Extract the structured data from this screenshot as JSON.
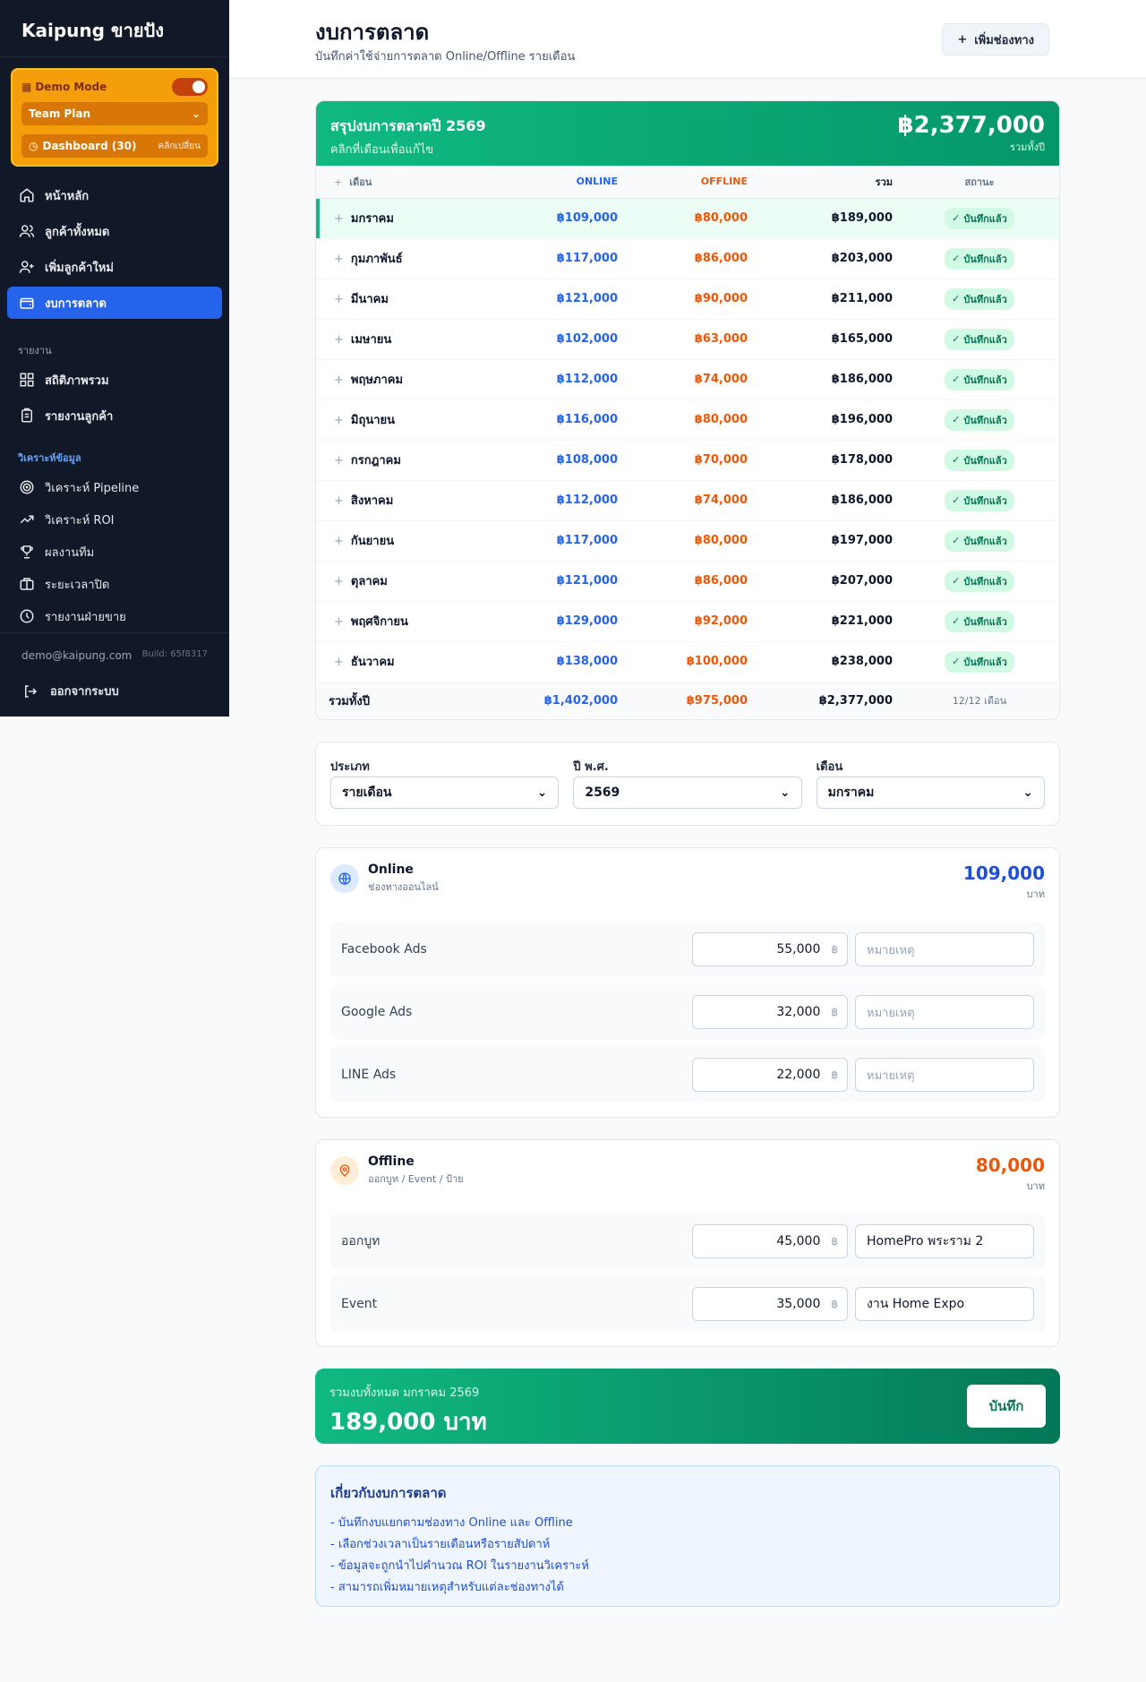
{
  "sidebar": {
    "brand": "Kaipung ขายปัง",
    "demo": {
      "title": "Demo Mode",
      "plan": "Team Plan",
      "dashboard_label": "Dashboard (30)",
      "dashboard_hint": "คลิกเปลี่ยน"
    },
    "nav": [
      {
        "label": "หน้าหลัก",
        "icon": "home-icon"
      },
      {
        "label": "ลูกค้าทั้งหมด",
        "icon": "users-icon"
      },
      {
        "label": "เพิ่มลูกค้าใหม่",
        "icon": "user-plus-icon"
      },
      {
        "label": "งบการตลาด",
        "icon": "wallet-icon",
        "active": true
      }
    ],
    "section_reports": "รายงาน",
    "reports": [
      {
        "label": "สถิติภาพรวม",
        "icon": "grid-icon"
      },
      {
        "label": "รายงานลูกค้า",
        "icon": "clipboard-icon"
      }
    ],
    "section_analysis": "วิเคราะห์ข้อมูล",
    "analysis": [
      {
        "label": "วิเคราะห์ Pipeline",
        "icon": "target-icon"
      },
      {
        "label": "วิเคราะห์ ROI",
        "icon": "trending-up-icon"
      },
      {
        "label": "ผลงานทีม",
        "icon": "trophy-icon"
      },
      {
        "label": "ระยะเวลาปิด",
        "icon": "briefcase-icon"
      },
      {
        "label": "รายงานฝ่ายขาย",
        "icon": "clock-icon"
      }
    ],
    "email": "demo@kaipung.com",
    "build": "Build: 65f8317",
    "logout": "ออกจากระบบ"
  },
  "header": {
    "title": "งบการตลาด",
    "subtitle": "บันทึกค่าใช้จ่ายการตลาด Online/Offline รายเดือน",
    "add_channel": "เพิ่มช่องทาง"
  },
  "summary": {
    "title": "สรุปงบการตลาดปี 2569",
    "subtitle": "คลิกที่เดือนเพื่อแก้ไข",
    "total": "฿2,377,000",
    "total_label": "รวมทั้งปี",
    "columns": {
      "month": "เดือน",
      "online": "ONLINE",
      "offline": "OFFLINE",
      "sum": "รวม",
      "status": "สถานะ"
    },
    "rows": [
      {
        "month": "มกราคม",
        "online": "฿109,000",
        "offline": "฿80,000",
        "sum": "฿189,000",
        "status": "บันทึกแล้ว"
      },
      {
        "month": "กุมภาพันธ์",
        "online": "฿117,000",
        "offline": "฿86,000",
        "sum": "฿203,000",
        "status": "บันทึกแล้ว"
      },
      {
        "month": "มีนาคม",
        "online": "฿121,000",
        "offline": "฿90,000",
        "sum": "฿211,000",
        "status": "บันทึกแล้ว"
      },
      {
        "month": "เมษายน",
        "online": "฿102,000",
        "offline": "฿63,000",
        "sum": "฿165,000",
        "status": "บันทึกแล้ว"
      },
      {
        "month": "พฤษภาคม",
        "online": "฿112,000",
        "offline": "฿74,000",
        "sum": "฿186,000",
        "status": "บันทึกแล้ว"
      },
      {
        "month": "มิถุนายน",
        "online": "฿116,000",
        "offline": "฿80,000",
        "sum": "฿196,000",
        "status": "บันทึกแล้ว"
      },
      {
        "month": "กรกฎาคม",
        "online": "฿108,000",
        "offline": "฿70,000",
        "sum": "฿178,000",
        "status": "บันทึกแล้ว"
      },
      {
        "month": "สิงหาคม",
        "online": "฿112,000",
        "offline": "฿74,000",
        "sum": "฿186,000",
        "status": "บันทึกแล้ว"
      },
      {
        "month": "กันยายน",
        "online": "฿117,000",
        "offline": "฿80,000",
        "sum": "฿197,000",
        "status": "บันทึกแล้ว"
      },
      {
        "month": "ตุลาคม",
        "online": "฿121,000",
        "offline": "฿86,000",
        "sum": "฿207,000",
        "status": "บันทึกแล้ว"
      },
      {
        "month": "พฤศจิกายน",
        "online": "฿129,000",
        "offline": "฿92,000",
        "sum": "฿221,000",
        "status": "บันทึกแล้ว"
      },
      {
        "month": "ธันวาคม",
        "online": "฿138,000",
        "offline": "฿100,000",
        "sum": "฿238,000",
        "status": "บันทึกแล้ว"
      }
    ],
    "footer": {
      "label": "รวมทั้งปี",
      "online": "฿1,402,000",
      "offline": "฿975,000",
      "sum": "฿2,377,000",
      "status": "12/12 เดือน"
    }
  },
  "filters": {
    "type_label": "ประเภท",
    "type_value": "รายเดือน",
    "year_label": "ปี พ.ศ.",
    "year_value": "2569",
    "month_label": "เดือน",
    "month_value": "มกราคม"
  },
  "online": {
    "name": "Online",
    "desc": "ช่องทางออนไลน์",
    "total": "109,000",
    "unit": "บาท",
    "items": [
      {
        "name": "Facebook Ads",
        "amount": "55,000",
        "note": "หมายเหตุ"
      },
      {
        "name": "Google Ads",
        "amount": "32,000",
        "note": "หมายเหตุ"
      },
      {
        "name": "LINE Ads",
        "amount": "22,000",
        "note": "หมายเหตุ"
      }
    ]
  },
  "offline": {
    "name": "Offline",
    "desc": "ออกบูท / Event / ป้าย",
    "total": "80,000",
    "unit": "บาท",
    "items": [
      {
        "name": "ออกบูท",
        "amount": "45,000",
        "note": "HomePro พระราม 2"
      },
      {
        "name": "Event",
        "amount": "35,000",
        "note": "งาน Home Expo"
      }
    ]
  },
  "currency_symbol": "฿",
  "total_bar": {
    "label": "รวมงบทั้งหมด มกราคม 2569",
    "value": "189,000 บาท",
    "save": "บันทึก"
  },
  "info": {
    "title": "เกี่ยวกับงบการตลาด",
    "items": [
      "- บันทึกงบแยกตามช่องทาง Online และ Offline",
      "- เลือกช่วงเวลาเป็นรายเดือนหรือรายสัปดาห์",
      "- ข้อมูลจะถูกนำไปคำนวณ ROI ในรายงานวิเคราะห์",
      "- สามารถเพิ่มหมายเหตุสำหรับแต่ละช่องทางได้"
    ]
  },
  "colors": {
    "sidebar": "#111827",
    "accent": "#2563eb",
    "success": "#10b981",
    "online": "#2563eb",
    "offline": "#ea580c",
    "demo": "#f59e0b"
  }
}
